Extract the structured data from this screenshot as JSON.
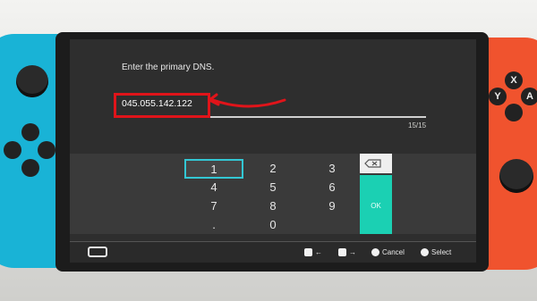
{
  "prompt": "Enter the primary DNS.",
  "dns_value": "045.055.142.122",
  "char_counter": "15/15",
  "keypad": {
    "keys": [
      "1",
      "2",
      "3",
      "4",
      "5",
      "6",
      "7",
      "8",
      "9",
      ".",
      "0"
    ],
    "selected_key": "1",
    "ok_label": "OK"
  },
  "footer": {
    "left_label": "←",
    "right_label": "→",
    "cancel_label": "Cancel",
    "select_label": "Select"
  },
  "controller_buttons": {
    "x": "X",
    "y": "Y",
    "a": "A"
  },
  "colors": {
    "highlight": "#e0141a",
    "selected_key": "#33c7d4",
    "ok_key": "#1bd0b3"
  }
}
